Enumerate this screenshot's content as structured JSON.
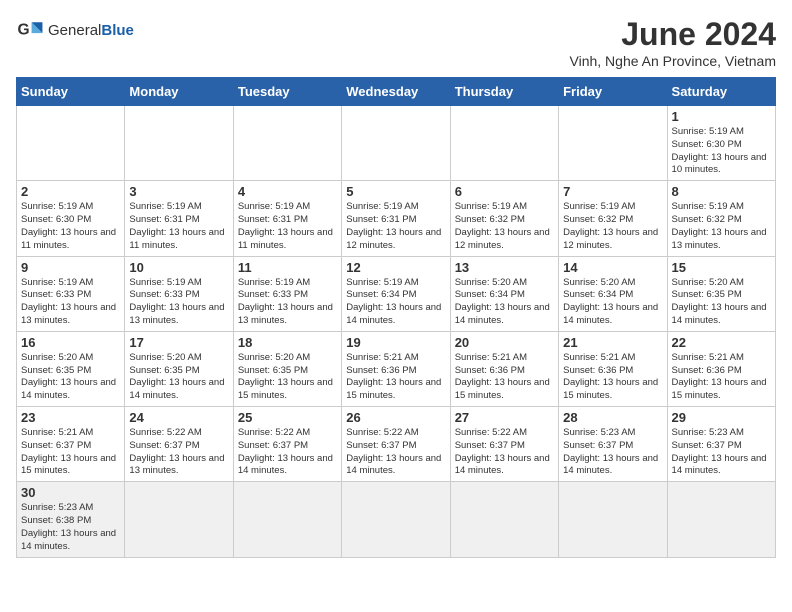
{
  "header": {
    "logo_general": "General",
    "logo_blue": "Blue",
    "month_title": "June 2024",
    "location": "Vinh, Nghe An Province, Vietnam"
  },
  "days_of_week": [
    "Sunday",
    "Monday",
    "Tuesday",
    "Wednesday",
    "Thursday",
    "Friday",
    "Saturday"
  ],
  "weeks": [
    [
      {
        "day": "",
        "info": ""
      },
      {
        "day": "",
        "info": ""
      },
      {
        "day": "",
        "info": ""
      },
      {
        "day": "",
        "info": ""
      },
      {
        "day": "",
        "info": ""
      },
      {
        "day": "",
        "info": ""
      },
      {
        "day": "1",
        "info": "Sunrise: 5:19 AM\nSunset: 6:30 PM\nDaylight: 13 hours\nand 10 minutes."
      }
    ],
    [
      {
        "day": "2",
        "info": "Sunrise: 5:19 AM\nSunset: 6:30 PM\nDaylight: 13 hours\nand 11 minutes."
      },
      {
        "day": "3",
        "info": "Sunrise: 5:19 AM\nSunset: 6:31 PM\nDaylight: 13 hours\nand 11 minutes."
      },
      {
        "day": "4",
        "info": "Sunrise: 5:19 AM\nSunset: 6:31 PM\nDaylight: 13 hours\nand 11 minutes."
      },
      {
        "day": "5",
        "info": "Sunrise: 5:19 AM\nSunset: 6:31 PM\nDaylight: 13 hours\nand 12 minutes."
      },
      {
        "day": "6",
        "info": "Sunrise: 5:19 AM\nSunset: 6:32 PM\nDaylight: 13 hours\nand 12 minutes."
      },
      {
        "day": "7",
        "info": "Sunrise: 5:19 AM\nSunset: 6:32 PM\nDaylight: 13 hours\nand 12 minutes."
      },
      {
        "day": "8",
        "info": "Sunrise: 5:19 AM\nSunset: 6:32 PM\nDaylight: 13 hours\nand 13 minutes."
      }
    ],
    [
      {
        "day": "9",
        "info": "Sunrise: 5:19 AM\nSunset: 6:33 PM\nDaylight: 13 hours\nand 13 minutes."
      },
      {
        "day": "10",
        "info": "Sunrise: 5:19 AM\nSunset: 6:33 PM\nDaylight: 13 hours\nand 13 minutes."
      },
      {
        "day": "11",
        "info": "Sunrise: 5:19 AM\nSunset: 6:33 PM\nDaylight: 13 hours\nand 13 minutes."
      },
      {
        "day": "12",
        "info": "Sunrise: 5:19 AM\nSunset: 6:34 PM\nDaylight: 13 hours\nand 14 minutes."
      },
      {
        "day": "13",
        "info": "Sunrise: 5:20 AM\nSunset: 6:34 PM\nDaylight: 13 hours\nand 14 minutes."
      },
      {
        "day": "14",
        "info": "Sunrise: 5:20 AM\nSunset: 6:34 PM\nDaylight: 13 hours\nand 14 minutes."
      },
      {
        "day": "15",
        "info": "Sunrise: 5:20 AM\nSunset: 6:35 PM\nDaylight: 13 hours\nand 14 minutes."
      }
    ],
    [
      {
        "day": "16",
        "info": "Sunrise: 5:20 AM\nSunset: 6:35 PM\nDaylight: 13 hours\nand 14 minutes."
      },
      {
        "day": "17",
        "info": "Sunrise: 5:20 AM\nSunset: 6:35 PM\nDaylight: 13 hours\nand 14 minutes."
      },
      {
        "day": "18",
        "info": "Sunrise: 5:20 AM\nSunset: 6:35 PM\nDaylight: 13 hours\nand 15 minutes."
      },
      {
        "day": "19",
        "info": "Sunrise: 5:21 AM\nSunset: 6:36 PM\nDaylight: 13 hours\nand 15 minutes."
      },
      {
        "day": "20",
        "info": "Sunrise: 5:21 AM\nSunset: 6:36 PM\nDaylight: 13 hours\nand 15 minutes."
      },
      {
        "day": "21",
        "info": "Sunrise: 5:21 AM\nSunset: 6:36 PM\nDaylight: 13 hours\nand 15 minutes."
      },
      {
        "day": "22",
        "info": "Sunrise: 5:21 AM\nSunset: 6:36 PM\nDaylight: 13 hours\nand 15 minutes."
      }
    ],
    [
      {
        "day": "23",
        "info": "Sunrise: 5:21 AM\nSunset: 6:37 PM\nDaylight: 13 hours\nand 15 minutes."
      },
      {
        "day": "24",
        "info": "Sunrise: 5:22 AM\nSunset: 6:37 PM\nDaylight: 13 hours\nand 13 minutes."
      },
      {
        "day": "25",
        "info": "Sunrise: 5:22 AM\nSunset: 6:37 PM\nDaylight: 13 hours\nand 14 minutes."
      },
      {
        "day": "26",
        "info": "Sunrise: 5:22 AM\nSunset: 6:37 PM\nDaylight: 13 hours\nand 14 minutes."
      },
      {
        "day": "27",
        "info": "Sunrise: 5:22 AM\nSunset: 6:37 PM\nDaylight: 13 hours\nand 14 minutes."
      },
      {
        "day": "28",
        "info": "Sunrise: 5:23 AM\nSunset: 6:37 PM\nDaylight: 13 hours\nand 14 minutes."
      },
      {
        "day": "29",
        "info": "Sunrise: 5:23 AM\nSunset: 6:37 PM\nDaylight: 13 hours\nand 14 minutes."
      }
    ],
    [
      {
        "day": "30",
        "info": "Sunrise: 5:23 AM\nSunset: 6:38 PM\nDaylight: 13 hours\nand 14 minutes."
      },
      {
        "day": "",
        "info": ""
      },
      {
        "day": "",
        "info": ""
      },
      {
        "day": "",
        "info": ""
      },
      {
        "day": "",
        "info": ""
      },
      {
        "day": "",
        "info": ""
      },
      {
        "day": "",
        "info": ""
      }
    ]
  ]
}
